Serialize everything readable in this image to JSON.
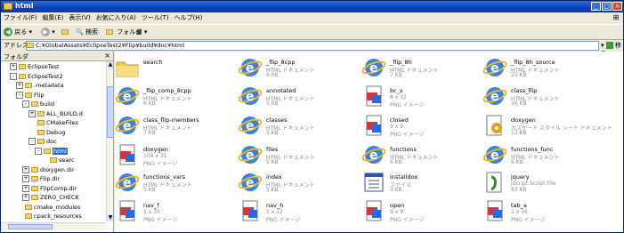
{
  "window": {
    "title": "html"
  },
  "titlebar": {
    "minimize": "_",
    "maximize": "□",
    "close": "×"
  },
  "menu": [
    "ファイル(F)",
    "編集(E)",
    "表示(V)",
    "お気に入り(A)",
    "ツール(T)",
    "ヘルプ(H)"
  ],
  "toolbar": {
    "back_label": "戻る",
    "search_label": "検索",
    "folders_label": "フォルダ",
    "view_label": ""
  },
  "address": {
    "label": "アドレス(D)",
    "path": "C:¥GlobalAssets¥EclipseTest2¥Flip¥build¥doc¥html",
    "go_label": "移動"
  },
  "folder_pane": {
    "header": "フォルダ",
    "close": "×",
    "items": [
      {
        "label": "EclipseTest",
        "pm": "+"
      },
      {
        "label": "EclipseTest2",
        "pm": "-"
      },
      {
        "label": ".metadata",
        "pm": "+"
      },
      {
        "label": "Flip",
        "pm": "-"
      },
      {
        "label": "build",
        "pm": "-"
      },
      {
        "label": "ALL_BUILD.d",
        "pm": "+"
      },
      {
        "label": "CMakeFiles",
        "pm": ""
      },
      {
        "label": "Debug",
        "pm": ""
      },
      {
        "label": "doc",
        "pm": "-"
      },
      {
        "label": "html",
        "pm": "-"
      },
      {
        "label": "searc",
        "pm": ""
      },
      {
        "label": "doxygen.dir",
        "pm": "+"
      },
      {
        "label": "Flip.dir",
        "pm": "+"
      },
      {
        "label": "FlipComp.dir",
        "pm": "+"
      },
      {
        "label": "ZERO_CHECK",
        "pm": "+"
      },
      {
        "label": "cmake_modules",
        "pm": ""
      },
      {
        "label": "cpack_resources",
        "pm": ""
      }
    ]
  },
  "files": [
    {
      "name": "search",
      "line1": "",
      "line2": "",
      "icon": "folder-icon"
    },
    {
      "name": "_flip_8cpp",
      "line1": "HTML ドキュメント",
      "line2": "6 KB",
      "icon": "html-document-icon"
    },
    {
      "name": "_flip_8h",
      "line1": "HTML ドキュメント",
      "line2": "7 KB",
      "icon": "html-document-icon"
    },
    {
      "name": "_flip_8h_source",
      "line1": "HTML ドキュメント",
      "line2": "25 KB",
      "icon": "html-document-icon"
    },
    {
      "name": "_flip_comp_8cpp",
      "line1": "HTML ドキュメント",
      "line2": "6 KB",
      "icon": "html-document-icon"
    },
    {
      "name": "annotated",
      "line1": "HTML ドキュメント",
      "line2": "5 KB",
      "icon": "html-document-icon"
    },
    {
      "name": "bc_s",
      "line1": "8 x 32",
      "line2": "PNG イメージ",
      "icon": "png-image-icon"
    },
    {
      "name": "class_flip",
      "line1": "HTML ドキュメント",
      "line2": "16 KB",
      "icon": "html-document-icon"
    },
    {
      "name": "class_flip-members",
      "line1": "HTML ドキュメント",
      "line2": "7 KB",
      "icon": "html-document-icon"
    },
    {
      "name": "classes",
      "line1": "HTML ドキュメント",
      "line2": "5 KB",
      "icon": "html-document-icon"
    },
    {
      "name": "closed",
      "line1": "9 x 9",
      "line2": "PNG イメージ",
      "icon": "png-image-icon"
    },
    {
      "name": "doxygen",
      "line1": "カスケード スタイル シート ドキュメント",
      "line2": "13 KB",
      "icon": "css-document-icon"
    },
    {
      "name": "doxygen",
      "line1": "104 x 31",
      "line2": "PNG イメージ",
      "icon": "png-image-icon"
    },
    {
      "name": "files",
      "line1": "HTML ドキュメント",
      "line2": "5 KB",
      "icon": "html-document-icon"
    },
    {
      "name": "functions",
      "line1": "HTML ドキュメント",
      "line2": "6 KB",
      "icon": "html-document-icon"
    },
    {
      "name": "functions_func",
      "line1": "HTML ドキュメント",
      "line2": "6 KB",
      "icon": "html-document-icon"
    },
    {
      "name": "functions_vars",
      "line1": "HTML ドキュメント",
      "line2": "5 KB",
      "icon": "html-document-icon"
    },
    {
      "name": "index",
      "line1": "HTML ドキュメント",
      "line2": "5 KB",
      "icon": "html-document-icon"
    },
    {
      "name": "installdox",
      "line1": "ファイル",
      "line2": "3 KB",
      "icon": "generic-file-icon"
    },
    {
      "name": "jquery",
      "line1": "JScript Script File",
      "line2": "63 KB",
      "icon": "jscript-file-icon"
    },
    {
      "name": "nav_f",
      "line1": "1 x 30",
      "line2": "PNG イメージ",
      "icon": "png-image-icon"
    },
    {
      "name": "nav_h",
      "line1": "1 x 12",
      "line2": "PNG イメージ",
      "icon": "png-image-icon"
    },
    {
      "name": "open",
      "line1": "9 x 9",
      "line2": "PNG イメージ",
      "icon": "png-image-icon"
    },
    {
      "name": "tab_a",
      "line1": "1 x 36",
      "line2": "PNG イメージ",
      "icon": "png-image-icon"
    }
  ]
}
